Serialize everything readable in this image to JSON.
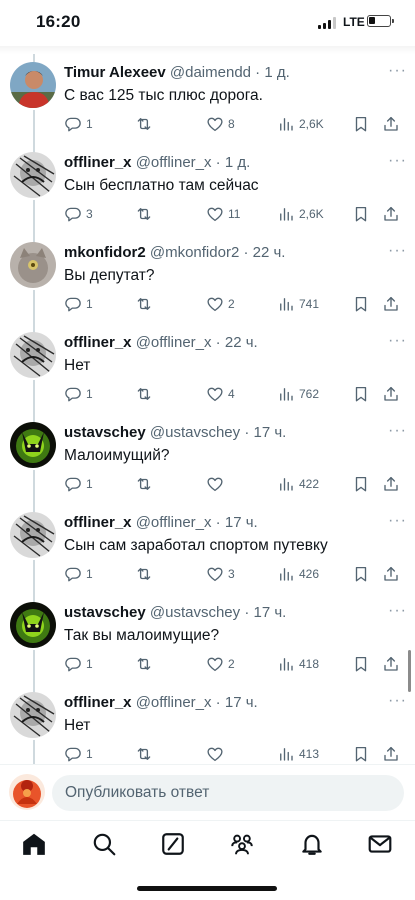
{
  "status_bar": {
    "time": "16:20",
    "network": "LTE",
    "battery_level": 0.3
  },
  "tweets": [
    {
      "name": "Timur Alexeev",
      "handle": "@daimendd",
      "time": "1 д.",
      "text": "С вас 125 тыс плюс дорога.",
      "replies": "1",
      "retweets": "",
      "likes": "8",
      "views": "2,6K",
      "avatar": "photo-man"
    },
    {
      "name": "offliner_x",
      "handle": "@offliner_x",
      "time": "1 д.",
      "text": "Сын бесплатно там сейчас",
      "replies": "3",
      "retweets": "",
      "likes": "11",
      "views": "2,6K",
      "avatar": "sketch"
    },
    {
      "name": "mkonfidor2",
      "handle": "@mkonfidor2",
      "time": "22 ч.",
      "text": "Вы депутат?",
      "replies": "1",
      "retweets": "",
      "likes": "2",
      "views": "741",
      "avatar": "grey-cat"
    },
    {
      "name": "offliner_x",
      "handle": "@offliner_x",
      "time": "22 ч.",
      "text": "Нет",
      "replies": "1",
      "retweets": "",
      "likes": "4",
      "views": "762",
      "avatar": "sketch"
    },
    {
      "name": "ustavschey",
      "handle": "@ustavschey",
      "time": "17 ч.",
      "text": "Малоимущий?",
      "replies": "1",
      "retweets": "",
      "likes": "",
      "views": "422",
      "avatar": "green-glow"
    },
    {
      "name": "offliner_x",
      "handle": "@offliner_x",
      "time": "17 ч.",
      "text": "Сын сам заработал спортом путевку",
      "replies": "1",
      "retweets": "",
      "likes": "3",
      "views": "426",
      "avatar": "sketch"
    },
    {
      "name": "ustavschey",
      "handle": "@ustavschey",
      "time": "17 ч.",
      "text": "Так вы малоимущие?",
      "replies": "1",
      "retweets": "",
      "likes": "2",
      "views": "418",
      "avatar": "green-glow"
    },
    {
      "name": "offliner_x",
      "handle": "@offliner_x",
      "time": "17 ч.",
      "text": "Нет",
      "replies": "1",
      "retweets": "",
      "likes": "",
      "views": "413",
      "avatar": "sketch"
    }
  ],
  "more_glyph": "···",
  "reply": {
    "placeholder": "Опубликовать ответ"
  },
  "tabs": [
    "home-icon",
    "search-icon",
    "grok-icon",
    "communities-icon",
    "notifications-icon",
    "messages-icon"
  ],
  "colors": {
    "text": "#0f1419",
    "secondary": "#536471",
    "thread_line": "#cfd9de",
    "input_bg": "#eff3f4"
  }
}
